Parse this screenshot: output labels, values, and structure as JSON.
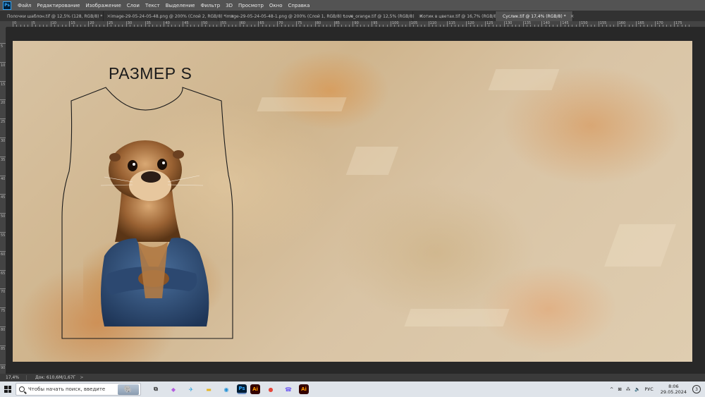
{
  "menu": {
    "items": [
      "Файл",
      "Редактирование",
      "Изображение",
      "Слои",
      "Текст",
      "Выделение",
      "Фильтр",
      "3D",
      "Просмотр",
      "Окно",
      "Справка"
    ]
  },
  "tabs": [
    {
      "label": "Полочки шаблон.tif @ 12,5% (128, RGB/8) *",
      "active": false
    },
    {
      "label": "image-29-05-24-05-48.png @ 200% (Слой 2, RGB/8) *",
      "active": false
    },
    {
      "label": "image-29-05-24-05-48-1.png @ 200% (Слой 1, RGB/8) *",
      "active": false
    },
    {
      "label": "Love_orange.tif @ 12,5% (RGB/8)",
      "active": false
    },
    {
      "label": "Котик в цветах.tif @ 16,7% (RGB/8)",
      "active": false
    },
    {
      "label": "Суслик.tif @ 17,4% (RGB/8) *",
      "active": true
    }
  ],
  "ruler_h_labels": [
    "0",
    "5",
    "10",
    "15",
    "20",
    "25",
    "30",
    "35",
    "40",
    "45",
    "50",
    "55",
    "60",
    "65",
    "70",
    "75",
    "80",
    "85",
    "90",
    "95",
    "100",
    "105",
    "110",
    "115",
    "120",
    "125",
    "130",
    "135",
    "140",
    "145",
    "150",
    "155",
    "160",
    "165",
    "170",
    "175"
  ],
  "ruler_v_labels": [
    "5",
    "10",
    "15",
    "20",
    "25",
    "30",
    "35",
    "40",
    "45",
    "50",
    "55",
    "60",
    "65",
    "70",
    "75",
    "80",
    "85",
    "90"
  ],
  "canvas": {
    "size_label": "РАЗМЕР S"
  },
  "status": {
    "zoom": "17,4%",
    "doc": "Док: 610,6M/1,67Г",
    "arrow": ">"
  },
  "taskbar": {
    "search_placeholder": "Чтобы начать поиск, введите",
    "apps": [
      {
        "name": "task-view",
        "glyph": "⧉",
        "color": "#333"
      },
      {
        "name": "copilot",
        "glyph": "◆",
        "color": "#b45de0"
      },
      {
        "name": "telegram",
        "glyph": "✈",
        "color": "#2aa3e0"
      },
      {
        "name": "file-explorer",
        "glyph": "▬",
        "color": "#e6b422"
      },
      {
        "name": "edge",
        "glyph": "◉",
        "color": "#1c8fd6"
      },
      {
        "name": "photoshop",
        "glyph": "Ps",
        "color": "#31a8ff"
      },
      {
        "name": "illustrator",
        "glyph": "Ai",
        "color": "#ff9a00"
      },
      {
        "name": "chrome",
        "glyph": "●",
        "color": "#e5463b"
      },
      {
        "name": "viber",
        "glyph": "☎",
        "color": "#7360f2"
      },
      {
        "name": "illustrator-2",
        "glyph": "Ai",
        "color": "#ff9a00"
      }
    ],
    "tray": {
      "chevron": "^",
      "icons": [
        "⊠",
        "⁂",
        "🔈"
      ],
      "lang": "РУС",
      "time": "8:06",
      "date": "29.05.2024",
      "notifications": "3"
    }
  },
  "colors": {
    "menubar": "#535353",
    "tabbar": "#323232",
    "active_tab": "#505050",
    "taskbar": "#dfe4ea",
    "photoshop_accent": "#31a8ff"
  }
}
